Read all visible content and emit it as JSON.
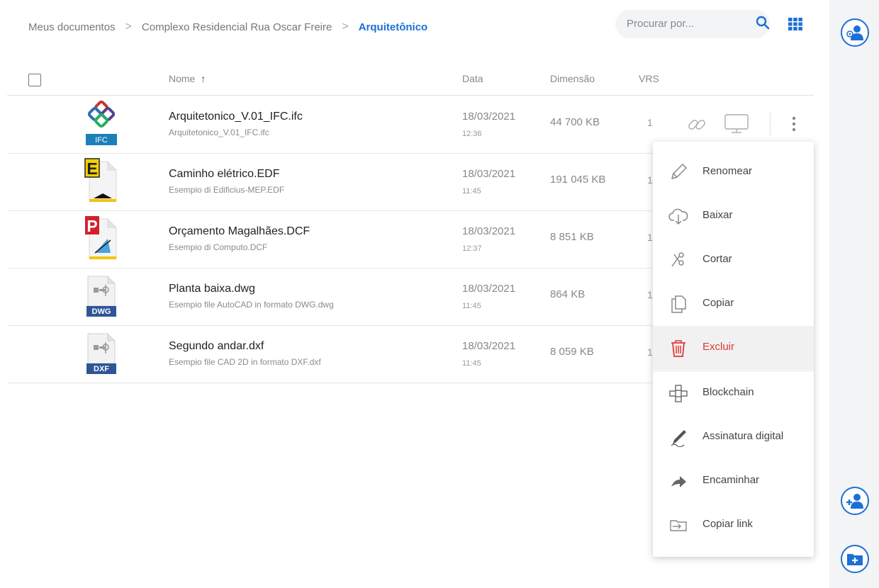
{
  "breadcrumb": {
    "items": [
      "Meus documentos",
      "Complexo Residencial Rua Oscar Freire",
      "Arquitetônico"
    ],
    "separator": ">"
  },
  "search": {
    "placeholder": "Procurar por..."
  },
  "icons": {
    "search": "search-icon",
    "view": "grid-view-icon",
    "user_settings": "user-settings-icon",
    "add_user": "add-user-icon",
    "add_folder": "add-folder-icon"
  },
  "table": {
    "headers": {
      "name": "Nome",
      "sort_arrow": "↑",
      "date": "Data",
      "size": "Dimensão",
      "vrs": "VRS"
    },
    "rows": [
      {
        "name": "Arquitetonico_V.01_IFC.ifc",
        "sub": "Arquitetonico_V.01_IFC.ifc",
        "date": "18/03/2021",
        "time": "12:36",
        "size": "44 700 KB",
        "vrs": "1",
        "type": "IFC"
      },
      {
        "name": "Caminho elétrico.EDF",
        "sub": "Esempio di Edificius-MEP.EDF",
        "date": "18/03/2021",
        "time": "11:45",
        "size": "191 045 KB",
        "vrs": "1",
        "type": "E"
      },
      {
        "name": "Orçamento Magalhães.DCF",
        "sub": "Esempio di Computo.DCF",
        "date": "18/03/2021",
        "time": "12:37",
        "size": "8 851 KB",
        "vrs": "1",
        "type": "P"
      },
      {
        "name": "Planta baixa.dwg",
        "sub": "Esempio file AutoCAD in formato DWG.dwg",
        "date": "18/03/2021",
        "time": "11:45",
        "size": "864 KB",
        "vrs": "1",
        "type": "DWG"
      },
      {
        "name": "Segundo andar.dxf",
        "sub": "Esempio file CAD 2D in formato DXF.dxf",
        "date": "18/03/2021",
        "time": "11:45",
        "size": "8 059 KB",
        "vrs": "1",
        "type": "DXF"
      }
    ]
  },
  "menu": {
    "items": [
      "Renomear",
      "Baixar",
      "Cortar",
      "Copiar",
      "Excluir",
      "Blockchain",
      "Assinatura digital",
      "Encaminhar",
      "Copiar link"
    ]
  },
  "colors": {
    "accent": "#1d6fd6",
    "danger": "#e03a3a",
    "rail": "#f3f4f6"
  }
}
